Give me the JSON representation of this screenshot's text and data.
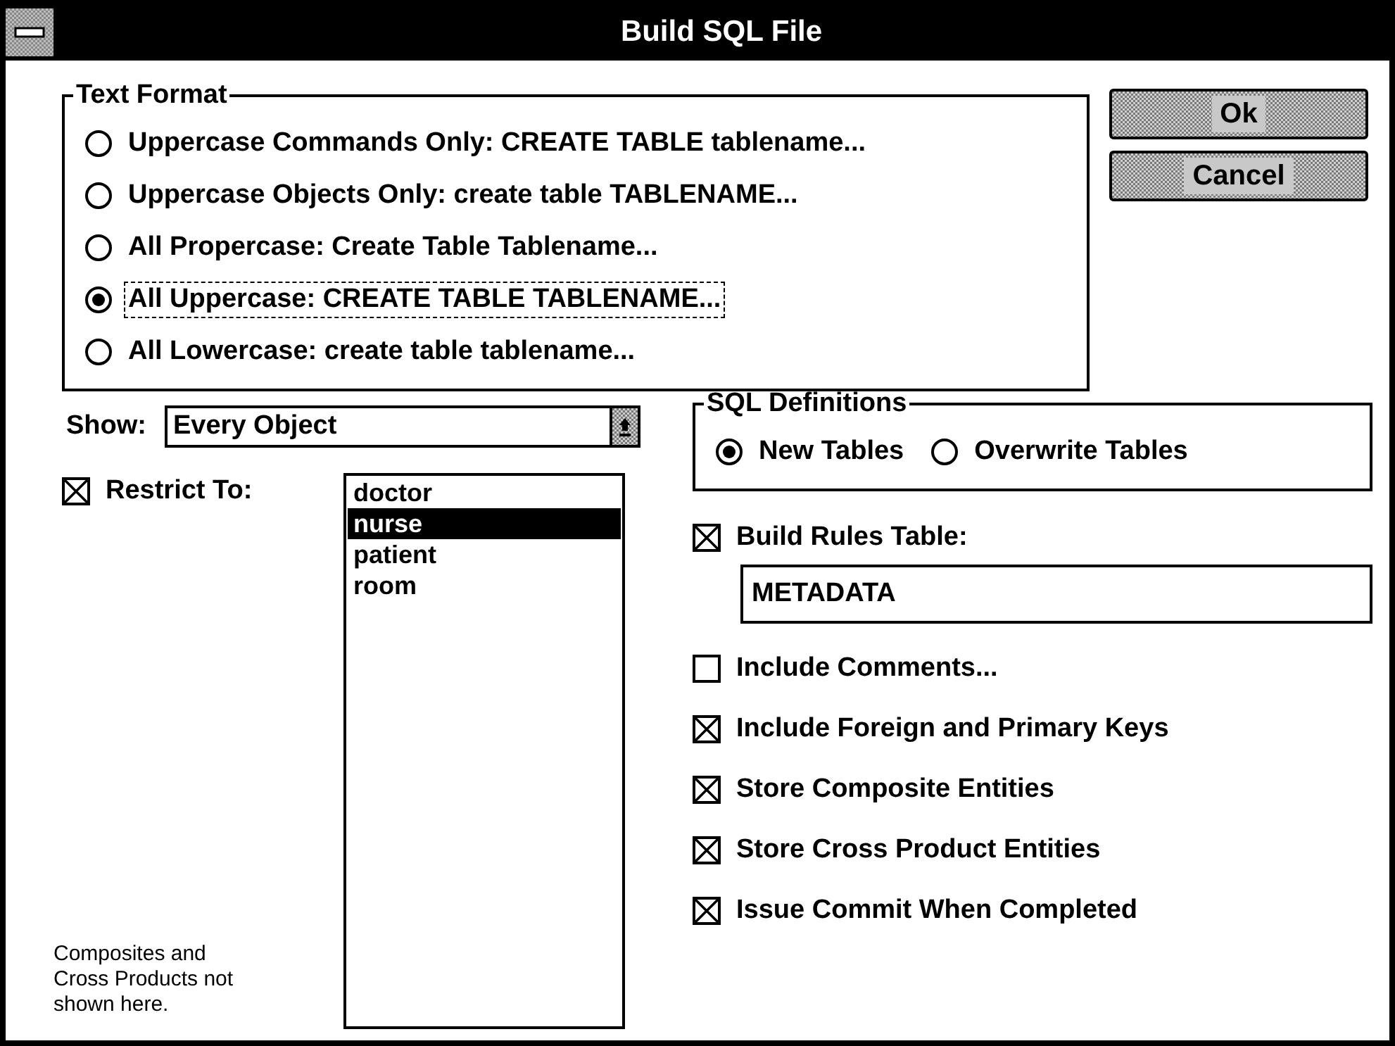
{
  "window": {
    "title": "Build SQL File"
  },
  "text_format": {
    "label": "Text Format",
    "options": [
      {
        "label": "Uppercase Commands Only: CREATE TABLE tablename...",
        "selected": false
      },
      {
        "label": "Uppercase Objects Only: create table TABLENAME...",
        "selected": false
      },
      {
        "label": "All Propercase: Create Table Tablename...",
        "selected": false
      },
      {
        "label": "All Uppercase: CREATE TABLE TABLENAME...",
        "selected": true
      },
      {
        "label": "All Lowercase: create table tablename...",
        "selected": false
      }
    ]
  },
  "buttons": [
    {
      "label": "Ok"
    },
    {
      "label": "Cancel"
    }
  ],
  "show": {
    "label": "Show:",
    "value": "Every Object"
  },
  "restrict": {
    "label": "Restrict To:",
    "checked": true,
    "items": [
      {
        "label": "doctor",
        "selected": false
      },
      {
        "label": "nurse",
        "selected": true
      },
      {
        "label": "patient",
        "selected": false
      },
      {
        "label": "room",
        "selected": false
      }
    ]
  },
  "note": "Composites and Cross Products not shown here.",
  "sql_definitions": {
    "label": "SQL Definitions",
    "options": [
      {
        "label": "New Tables",
        "selected": true
      },
      {
        "label": "Overwrite Tables",
        "selected": false
      }
    ]
  },
  "build_rules": {
    "label": "Build Rules Table:",
    "checked": true,
    "value": "METADATA"
  },
  "options": [
    {
      "label": "Include Comments...",
      "checked": false
    },
    {
      "label": "Include Foreign and Primary Keys",
      "checked": true
    },
    {
      "label": "Store Composite Entities",
      "checked": true
    },
    {
      "label": "Store Cross Product Entities",
      "checked": true
    },
    {
      "label": "Issue Commit When Completed",
      "checked": true
    }
  ]
}
